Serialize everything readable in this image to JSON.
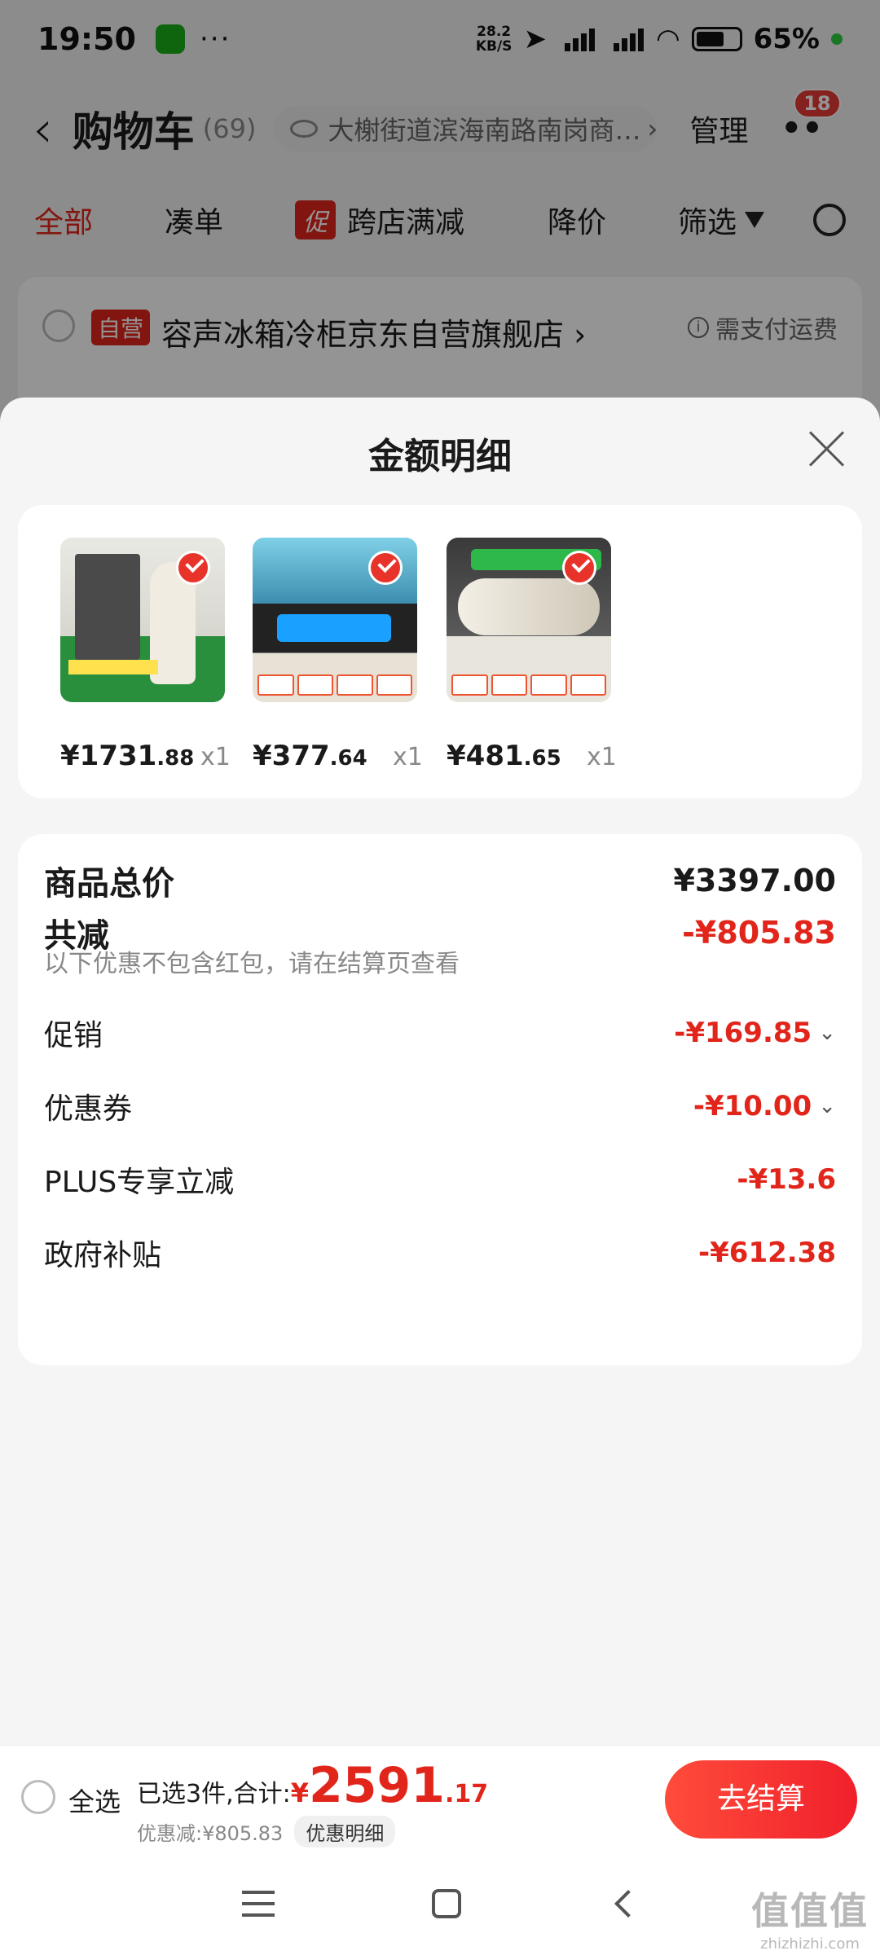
{
  "status_bar": {
    "time": "19:50",
    "net_speed_value": "28.2",
    "net_speed_unit": "KB/S",
    "battery": "65%"
  },
  "nav": {
    "title": "购物车",
    "count": "(69)",
    "address": "大榭街道滨海南路南岗商…",
    "manage": "管理",
    "badge": "18"
  },
  "tabs": {
    "all": "全部",
    "combine": "凑单",
    "promo_tag": "促",
    "cross_store": "跨店满减",
    "price_drop": "降价",
    "filter": "筛选"
  },
  "shop": {
    "self_tag": "自营",
    "name": "容声冰箱冷柜京东自营旗舰店 ›",
    "shipping_note": "需支付运费"
  },
  "sheet": {
    "title": "金额明细",
    "products": [
      {
        "price_int": "¥1731",
        "price_dec": ".88",
        "qty": "x1"
      },
      {
        "price_int": "¥377",
        "price_dec": ".64",
        "qty": "x1"
      },
      {
        "price_int": "¥481",
        "price_dec": ".65",
        "qty": "x1"
      }
    ],
    "total_label": "商品总价",
    "total_value": "¥3397.00",
    "reduce_label": "共减",
    "reduce_value": "-¥805.83",
    "reduce_note": "以下优惠不包含红包，请在结算页查看",
    "lines": [
      {
        "label": "促销",
        "value": "-¥169.85"
      },
      {
        "label": "优惠券",
        "value": "-¥10.00"
      },
      {
        "label": "PLUS专享立减",
        "value": "-¥13.6"
      },
      {
        "label": "政府补贴",
        "value": "-¥612.38"
      }
    ]
  },
  "bottom": {
    "select_all": "全选",
    "summary_prefix": "已选3件,合计:",
    "total_currency": "¥",
    "total_int": "2591",
    "total_dec": ".17",
    "discount_text": "优惠减:¥805.83",
    "discount_button": "优惠明细",
    "checkout": "去结算"
  },
  "watermark": {
    "big": "值值值",
    "small": "zhizhizhi.com"
  },
  "colors": {
    "accent_red": "#e1251b",
    "checkout_gradient": [
      "#ff4c3b",
      "#f0202b"
    ]
  }
}
